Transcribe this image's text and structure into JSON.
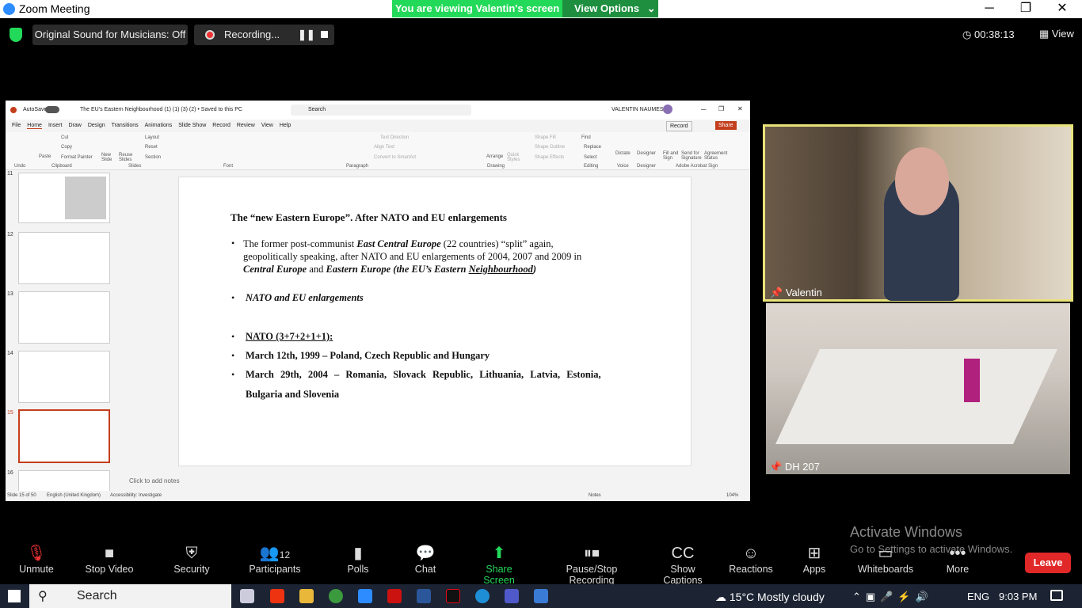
{
  "window": {
    "title": "Zoom Meeting"
  },
  "banner": {
    "viewing": "You are viewing Valentin's screen",
    "view_options": "View Options"
  },
  "topbar": {
    "original_sound": "Original Sound for Musicians: Off",
    "recording": "Recording...",
    "timer": "00:38:13",
    "view": "View"
  },
  "ppt": {
    "autosave": "AutoSave",
    "title": "The EU's Eastern Neighbourhood (1) (1) (3) (2) • Saved to this PC",
    "search": "Search",
    "user": "VALENTIN NAUMESCU",
    "record": "Record",
    "share": "Share",
    "menu": [
      "File",
      "Home",
      "Insert",
      "Draw",
      "Design",
      "Transitions",
      "Animations",
      "Slide Show",
      "Record",
      "Review",
      "View",
      "Help"
    ],
    "ribbon_groups": [
      "Undo",
      "Clipboard",
      "Slides",
      "Font",
      "Paragraph",
      "Drawing",
      "Editing",
      "Voice",
      "Designer",
      "Adobe Acrobat Sign"
    ],
    "ribbon_items": {
      "paste": "Paste",
      "cut": "Cut",
      "copy": "Copy",
      "format_painter": "Format Painter",
      "new_slide": "New Slide",
      "reuse": "Reuse Slides",
      "layout": "Layout",
      "reset": "Reset",
      "section": "Section",
      "arrange": "Arrange",
      "quick_styles": "Quick Styles",
      "find": "Find",
      "replace": "Replace",
      "select": "Select",
      "dictate": "Dictate",
      "designer": "Designer",
      "fill_sign": "Fill and Sign",
      "send_sig": "Send for Signature",
      "agreement": "Agreement Status",
      "text_direction": "Text Direction",
      "align_text": "Align Text",
      "convert_smartart": "Convert to SmartArt",
      "shape_fill": "Shape Fill",
      "shape_outline": "Shape Outline",
      "shape_effects": "Shape Effects"
    },
    "thumb_numbers": [
      "11",
      "12",
      "13",
      "14",
      "15",
      "16"
    ],
    "slide": {
      "title": "The “new Eastern Europe”. After NATO and EU enlargements",
      "b1_a": "The former post-communist ",
      "b1_b": "East Central Europe",
      "b1_c": " (22 countries) “split” again,",
      "b1_line2": "geopolitically speaking, after NATO and EU enlargements of 2004, 2007 and 2009 in",
      "b1_d": "Central Europe",
      "b1_e": " and ",
      "b1_f": "Eastern Europe (the EU’s Eastern ",
      "b1_g": "Neighbourhood",
      ")": ")",
      "b2": "NATO and EU enlargements",
      "b3": "NATO (3+7+2+1+1):",
      "b4": "March 12th, 1999 – Poland, Czech Republic and Hungary",
      "b5": "March 29th, 2004 – Romania, Slovack Republic, Lithuania, Latvia, Estonia,",
      "b5b": "Bulgaria and Slovenia"
    },
    "notes": "Click to add notes",
    "status": {
      "slide": "Slide 15 of 50",
      "lang": "English (United Kingdom)",
      "access": "Accessibility: Investigate",
      "notes": "Notes",
      "zoom": "104%"
    }
  },
  "videos": [
    {
      "name": "Valentin"
    },
    {
      "name": "DH 207"
    }
  ],
  "activate": {
    "title": "Activate Windows",
    "sub": "Go to Settings to activate Windows."
  },
  "toolbar": {
    "items": [
      "Unmute",
      "Stop Video",
      "Security",
      "Participants",
      "Polls",
      "Chat",
      "Share Screen",
      "Pause/Stop Recording",
      "Show Captions",
      "Reactions",
      "Apps",
      "Whiteboards",
      "More"
    ],
    "participants_count": "12",
    "leave": "Leave"
  },
  "taskbar": {
    "search": "Search",
    "weather": "15°C  Mostly cloudy",
    "lang": "ENG",
    "time": "9:03 PM"
  }
}
